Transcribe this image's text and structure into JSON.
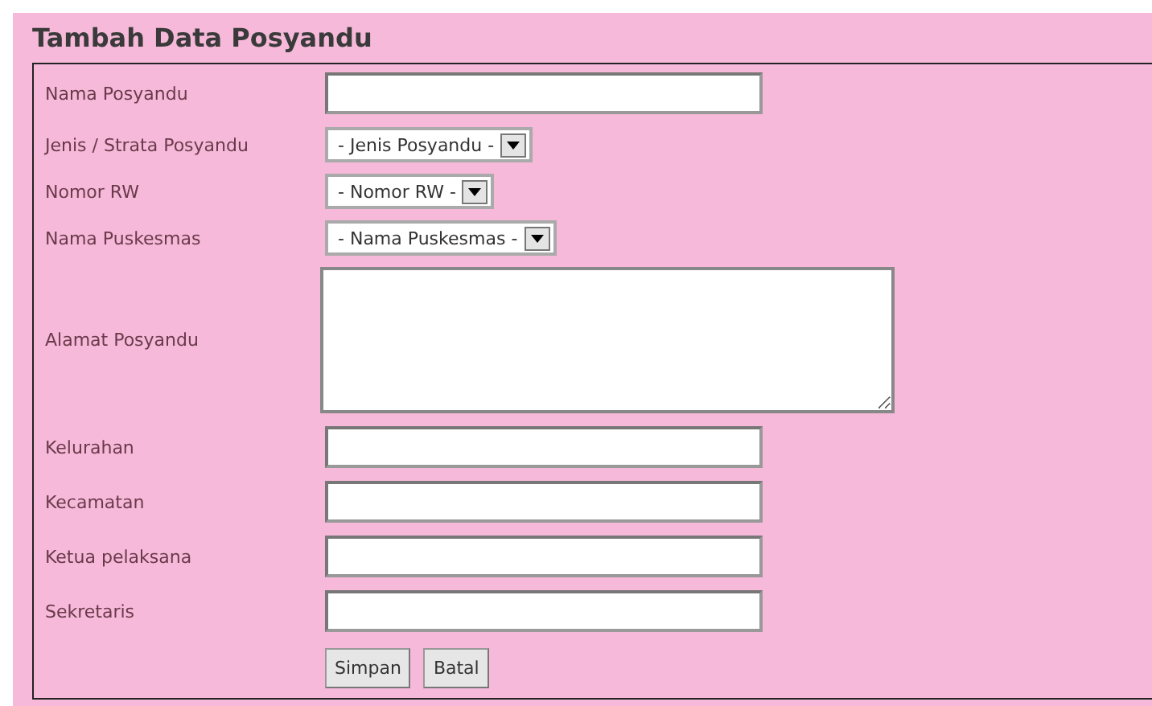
{
  "title": "Tambah Data Posyandu",
  "fields": [
    {
      "kind": "text",
      "label": "Nama Posyandu"
    },
    {
      "kind": "select",
      "label": "Jenis / Strata Posyandu",
      "value": "- Jenis Posyandu -"
    },
    {
      "kind": "select",
      "label": "Nomor RW",
      "value": "- Nomor RW -"
    },
    {
      "kind": "select",
      "label": "Nama Puskesmas",
      "value": "- Nama Puskesmas -"
    },
    {
      "kind": "textarea",
      "label": "Alamat Posyandu"
    },
    {
      "kind": "text",
      "label": "Kelurahan"
    },
    {
      "kind": "text",
      "label": "Kecamatan"
    },
    {
      "kind": "text",
      "label": "Ketua pelaksana"
    },
    {
      "kind": "text",
      "label": "Sekretaris"
    }
  ],
  "buttons": [
    "Simpan",
    "Batal"
  ]
}
